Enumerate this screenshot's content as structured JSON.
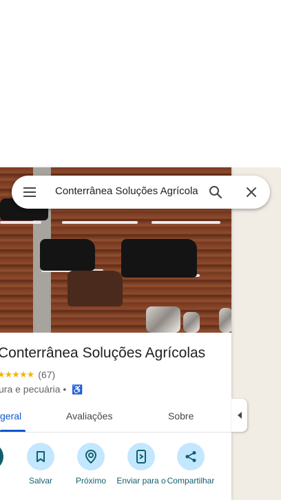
{
  "search": {
    "query": "Conterrânea Soluções Agrícolas"
  },
  "place": {
    "title": "Conterrânea Soluções Agrícolas",
    "rating_stars": "★★★★★",
    "review_count": "(67)",
    "category": "ura e pecuária •"
  },
  "tabs": [
    {
      "label": "geral",
      "active": true
    },
    {
      "label": "Avaliações",
      "active": false
    },
    {
      "label": "Sobre",
      "active": false
    }
  ],
  "actions": [
    {
      "label": "s",
      "icon": "directions-icon"
    },
    {
      "label": "Salvar",
      "icon": "bookmark-icon"
    },
    {
      "label": "Próximo",
      "icon": "nearby-icon"
    },
    {
      "label": "Enviar para o",
      "icon": "send-to-phone-icon"
    },
    {
      "label": "Compartilhar",
      "icon": "share-icon"
    }
  ],
  "colors": {
    "accent": "#0b57d0",
    "action_circle": "#c2e7ff",
    "action_label": "#0f5f6b",
    "star": "#f6b400",
    "map_bg": "#f1ece4"
  }
}
